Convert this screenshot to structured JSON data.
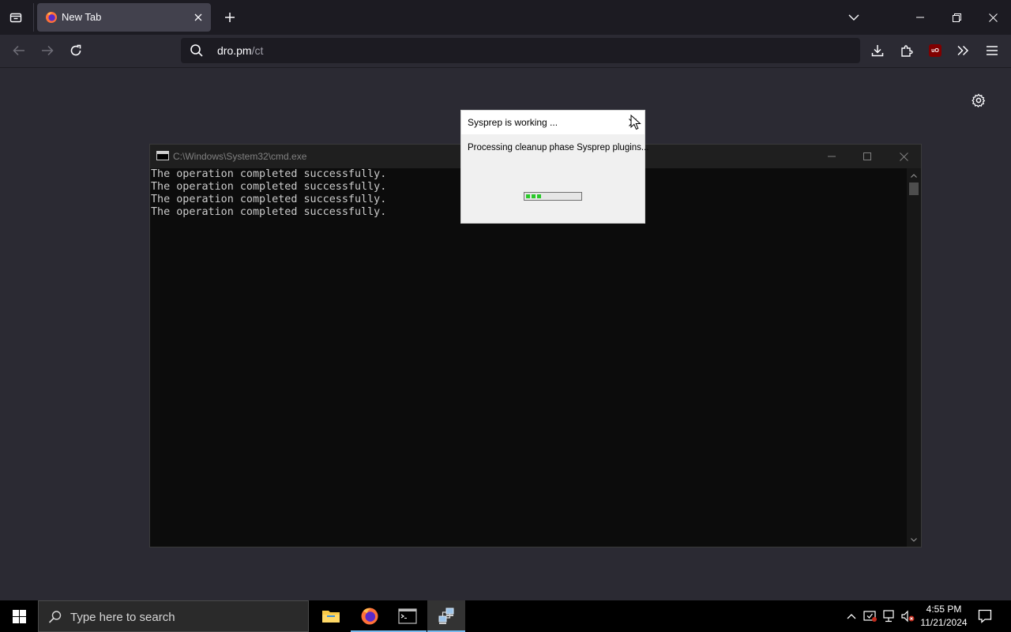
{
  "browser": {
    "tab": {
      "title": "New Tab",
      "favicon": "firefox-icon"
    },
    "url": {
      "host": "dro.pm",
      "path": "/ct"
    },
    "icons": {
      "tab_list": "tab-list-icon",
      "new_tab": "plus-icon",
      "list_all_tabs": "chevron-down-icon",
      "back": "back-arrow-icon",
      "forward": "forward-arrow-icon",
      "reload": "reload-icon",
      "downloads": "download-icon",
      "extensions": "extensions-icon",
      "ublock": "ublock-origin-icon",
      "overflow": "double-chevron-icon",
      "menu": "hamburger-menu-icon",
      "settings": "gear-icon"
    },
    "ublock_badge": "uO"
  },
  "cmd": {
    "title": "C:\\Windows\\System32\\cmd.exe",
    "lines": [
      "The operation completed successfully.",
      "The operation completed successfully.",
      "The operation completed successfully.",
      "The operation completed successfully."
    ]
  },
  "sysprep": {
    "title": "Sysprep is working ...",
    "message": "Processing cleanup phase Sysprep plugins...",
    "progress_segments": 3,
    "progress_color": "#2ac92a"
  },
  "taskbar": {
    "search_placeholder": "Type here to search",
    "apps": [
      "file-explorer-icon",
      "firefox-icon",
      "command-prompt-icon",
      "sysprep-icon"
    ],
    "clock": {
      "time": "4:55 PM",
      "date": "11/21/2024"
    },
    "tray": [
      "show-hidden-icons-chevron",
      "security-icon",
      "network-icon",
      "volume-muted-icon",
      "notification-icon"
    ]
  },
  "colors": {
    "browser_bg": "#2b2a33",
    "tabbar_bg": "#1c1b22",
    "tab_active": "#42414d",
    "cmd_bg": "#0c0c0c",
    "taskbar_bg": "#000000"
  }
}
